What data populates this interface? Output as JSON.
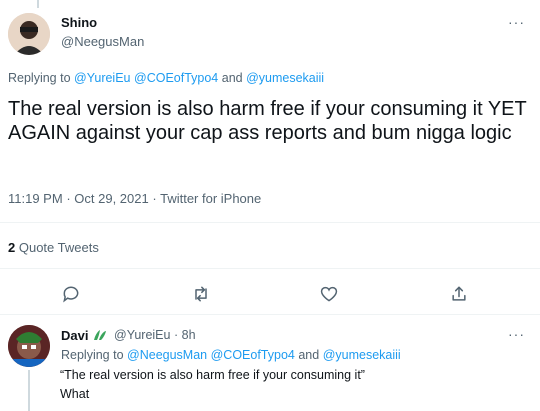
{
  "tweet": {
    "author_name": "Shino",
    "author_handle": "@NeegusMan",
    "replying_to_prefix": "Replying to",
    "replying_to_handles": [
      "@YureiEu",
      "@COEofTypo4",
      "@yumesekaiii"
    ],
    "replying_to_and": "and",
    "text": "The real version is also harm free if your consuming it YET AGAIN against your cap ass reports and bum nigga logic",
    "time": "11:19 PM",
    "date": "Oct 29, 2021",
    "source": "Twitter for iPhone",
    "quote_count": "2",
    "quote_label": "Quote Tweets",
    "more_icon": "···"
  },
  "reply": {
    "author_name": "Davi",
    "author_handle": "@YureiEu",
    "age": "8h",
    "replying_to_prefix": "Replying to",
    "replying_to_handles": [
      "@NeegusMan",
      "@COEofTypo4",
      "@yumesekaiii"
    ],
    "replying_to_and": "and",
    "line1": "“The real version is also harm free if your consuming it”",
    "line2": "What",
    "more_icon": "···"
  },
  "colors": {
    "link": "#1d9bf0",
    "secondary": "#536471",
    "badge_green": "#3ba55c"
  },
  "icons": [
    "reply-icon",
    "retweet-icon",
    "like-icon",
    "share-icon",
    "more-icon"
  ]
}
